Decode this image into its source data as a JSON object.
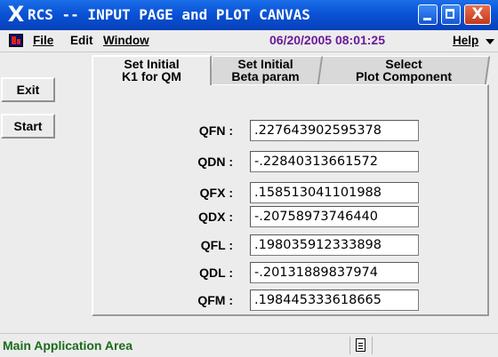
{
  "window": {
    "title": "RCS -- INPUT PAGE and PLOT CANVAS",
    "title_icon": "x-window-icon",
    "controls": {
      "minimize": "minimize-icon",
      "maximize": "maximize-icon",
      "close_glyph": "X"
    }
  },
  "menubar": {
    "app_icon": "app-icon",
    "items": [
      {
        "label": "File"
      },
      {
        "label": "Edit"
      },
      {
        "label": "Window"
      }
    ],
    "datetime": "06/20/2005 08:01:25",
    "help": "Help",
    "help_arrow_icon": "chevron-down-icon"
  },
  "side_buttons": {
    "exit": "Exit",
    "start": "Start"
  },
  "tabs": [
    {
      "line1": "Set Initial",
      "line2": "K1 for QM",
      "active": true
    },
    {
      "line1": "Set Initial",
      "line2": "Beta param",
      "active": false
    },
    {
      "line1": "Select",
      "line2": "Plot Component",
      "active": false
    }
  ],
  "fields": [
    {
      "label": "QFN :",
      "value": ".227643902595378"
    },
    {
      "label": "QDN :",
      "value": "-.22840313661572"
    },
    {
      "label": "QFX :",
      "value": ".158513041101988"
    },
    {
      "label": "QDX :",
      "value": "-.20758973746440"
    },
    {
      "label": "QFL :",
      "value": ".198035912333898"
    },
    {
      "label": "QDL :",
      "value": "-.20131889837974"
    },
    {
      "label": "QFM :",
      "value": ".198445333618665"
    }
  ],
  "statusbar": {
    "text": "Main Application Area",
    "doc_icon": "document-icon"
  },
  "colors": {
    "titlebar": "#0a52d6",
    "menu_date": "#6b1a9a",
    "status_text": "#1a6b1a",
    "close_button": "#c3381c"
  }
}
